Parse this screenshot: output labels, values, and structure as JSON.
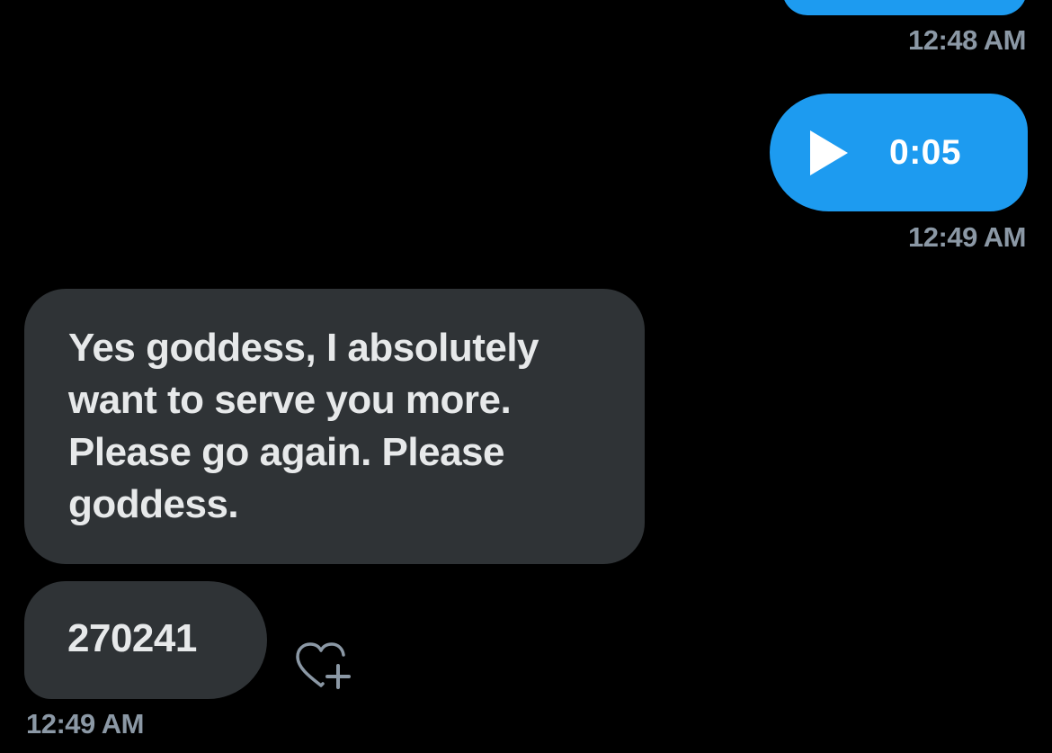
{
  "messages": {
    "previous_sent": {
      "timestamp": "12:48 AM"
    },
    "voice_message": {
      "play_icon": "play-icon",
      "duration": "0:05",
      "timestamp": "12:49 AM"
    },
    "received_text": {
      "text": "Yes goddess, I absolutely want to serve you more. Please go again. Please goddess."
    },
    "received_code": {
      "text": "270241",
      "react_icon": "heart-plus-icon",
      "timestamp": "12:49 AM"
    }
  },
  "colors": {
    "background": "#000000",
    "sent_bubble": "#1d9bf0",
    "received_bubble": "#2f3336",
    "timestamp": "#8b98a5",
    "text": "#e7e9ea"
  }
}
